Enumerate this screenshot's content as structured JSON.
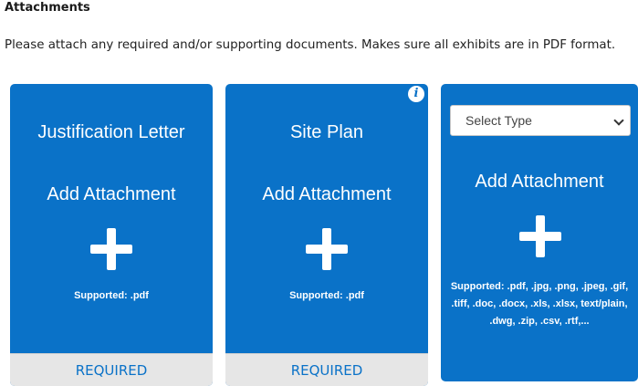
{
  "section": {
    "heading": "Attachments",
    "intro": "Please attach any required and/or supporting documents. Makes sure all exhibits are in PDF format."
  },
  "cards": [
    {
      "title": "Justification Letter",
      "add_label": "Add Attachment",
      "supported": "Supported: .pdf",
      "required_label": "REQUIRED"
    },
    {
      "title": "Site Plan",
      "add_label": "Add Attachment",
      "supported": "Supported: .pdf",
      "required_label": "REQUIRED",
      "info_icon": "i"
    },
    {
      "select_value": "Select Type",
      "add_label": "Add Attachment",
      "supported": "Supported: .pdf, .jpg, .png, .jpeg, .gif, .tiff, .doc, .docx, .xls, .xlsx, text/plain, .dwg, .zip, .csv, .rtf,..."
    }
  ],
  "colors": {
    "card_bg": "#0a72c8",
    "required_bg": "#e6e6e6",
    "required_text": "#0a72c8"
  },
  "icons": [
    "plus-icon",
    "info-icon",
    "chevron-down-icon"
  ]
}
